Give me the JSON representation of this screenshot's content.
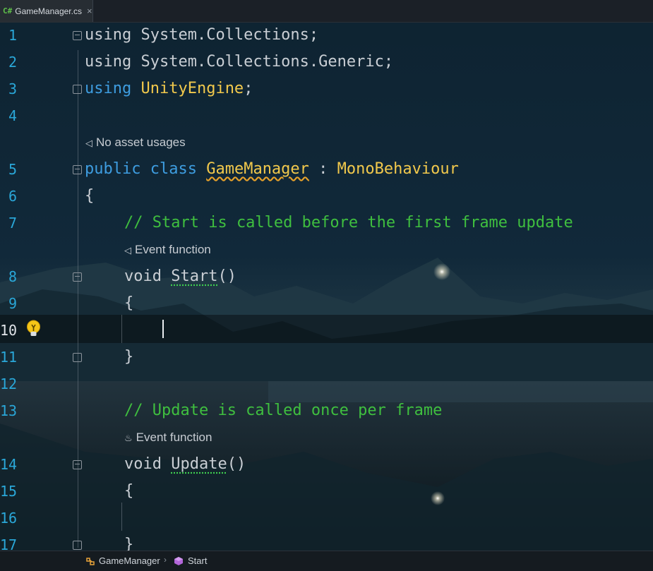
{
  "tab": {
    "lang_badge": "C#",
    "filename": "GameManager.cs",
    "close_glyph": "×"
  },
  "lines": [
    {
      "num": "1",
      "tokens": [
        [
          "kw0",
          "using"
        ],
        [
          "t",
          " System.Collections;"
        ]
      ]
    },
    {
      "num": "2"
    },
    {
      "num": "3"
    },
    {
      "num": "4"
    },
    {
      "num": "5"
    },
    {
      "num": "6"
    },
    {
      "num": "7"
    },
    {
      "num": "8"
    },
    {
      "num": "9"
    },
    {
      "num": "10"
    },
    {
      "num": "11"
    },
    {
      "num": "12"
    },
    {
      "num": "13"
    },
    {
      "num": "14"
    },
    {
      "num": "15"
    },
    {
      "num": "16"
    },
    {
      "num": "17"
    }
  ],
  "code": {
    "l1_kw": "using",
    "l1_rest": " System.Collections;",
    "l2_kw": "using",
    "l2_rest": " System.Collections.Generic;",
    "l3_kw": "using",
    "l3_ns": "UnityEngine",
    "l3_end": ";",
    "l5_kw1": "public",
    "l5_kw2": "class",
    "l5_cls": "GameManager",
    "l5_colon": " : ",
    "l5_base": "MonoBehaviour",
    "l6": "{",
    "l7_comment": "// Start is called before the first frame update",
    "l8_type": "void ",
    "l8_fn": "Start",
    "l8_paren": "()",
    "l9": "{",
    "l11": "}",
    "l13_comment": "// Update is called once per frame",
    "l14_type": "void ",
    "l14_fn": "Update",
    "l14_paren": "()",
    "l15": "{",
    "l17": "}"
  },
  "hints": {
    "asset_usages": "No asset usages",
    "event_function_start": "Event function",
    "event_function_update": "Event function"
  },
  "breadcrumb": {
    "class_name": "GameManager",
    "separator": "›",
    "method_name": "Start"
  },
  "colors": {
    "keyword": "#3e9de0",
    "class": "#f2c94c",
    "comment": "#3fbf3f",
    "line_number": "#2aa7d8",
    "text": "#c9ced4"
  },
  "icons": {
    "bulb": "lightbulb-icon",
    "unity_hint": "unity-icon",
    "flame_hint": "flame-icon",
    "class_crumb": "class-icon",
    "method_crumb": "method-icon",
    "fold": "fold-icon"
  }
}
